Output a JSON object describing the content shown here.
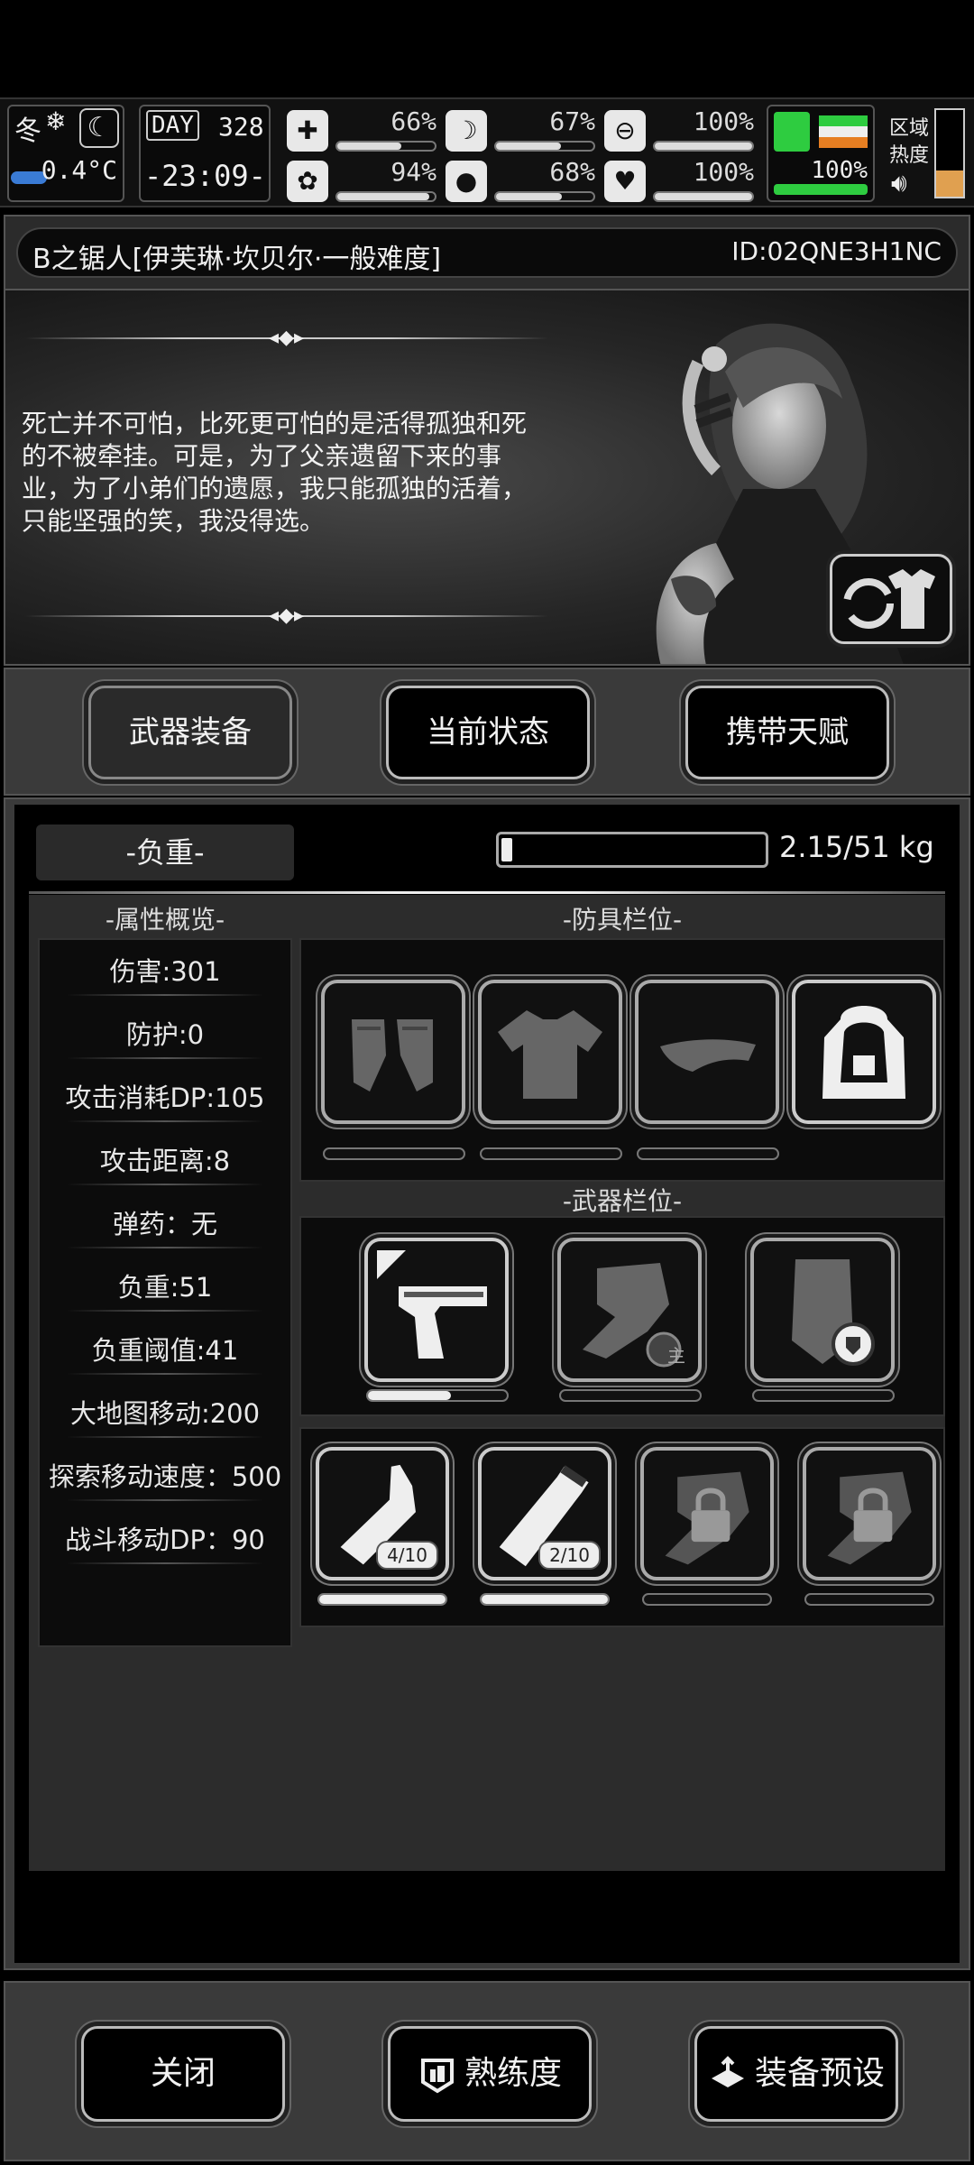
{
  "status": {
    "season": "冬",
    "day_label": "DAY",
    "day_value": "328",
    "temperature": "0.4°C",
    "clock": "-23:09-",
    "stats": [
      {
        "icon": "medkit-icon",
        "pct": "66%",
        "fill": 0.66
      },
      {
        "icon": "stomach-icon",
        "pct": "67%",
        "fill": 0.67
      },
      {
        "icon": "pill-icon",
        "pct": "100%",
        "fill": 1.0
      },
      {
        "icon": "brain-icon",
        "pct": "94%",
        "fill": 0.94
      },
      {
        "icon": "water-drop-icon",
        "pct": "68%",
        "fill": 0.68
      },
      {
        "icon": "heart-icon",
        "pct": "100%",
        "fill": 1.0
      }
    ],
    "stamina_pct": "100%",
    "region_heat_label_1": "区域",
    "region_heat_label_2": "热度",
    "colors": {
      "boot": "#2ecc40",
      "flag_green": "#2ecc40",
      "flag_white": "#eeeeee",
      "flag_orange": "#e67e22",
      "heat": "#e0a050"
    }
  },
  "character": {
    "name": "B之锯人[伊芙琳·坎贝尔·一般难度]",
    "id": "ID:02QNE3H1NC",
    "quote": "死亡并不可怕，比死更可怕的是活得孤独和死的不被牵挂。可是，为了父亲遗留下来的事业，为了小弟们的遗愿，我只能孤独的活着，只能坚强的笑，我没得选。"
  },
  "tabs": {
    "weapons": "武器装备",
    "status": "当前状态",
    "talents": "携带天赋"
  },
  "load": {
    "title": "-负重-",
    "value_text": "2.15/51 kg",
    "fraction": 0.042
  },
  "attributes": {
    "title": "-属性概览-",
    "items": [
      "伤害:301",
      "防护:0",
      "攻击消耗DP:105",
      "攻击距离:8",
      "弹药：无",
      "负重:51",
      "负重阈值:41",
      "大地图移动:200",
      "探索移动速度：500",
      "战斗移动DP：90"
    ]
  },
  "armor": {
    "title": "-防具栏位-",
    "slots": [
      {
        "icon": "gloves-icon"
      },
      {
        "icon": "shirt-icon"
      },
      {
        "icon": "cap-icon"
      },
      {
        "icon": "backpack-icon"
      }
    ]
  },
  "weapons": {
    "title": "-武器栏位-",
    "slots": [
      {
        "icon": "pistol-icon",
        "durability": 0.6
      },
      {
        "icon": "fist-icon",
        "badge": "主"
      },
      {
        "icon": "riot-shield-icon"
      }
    ]
  },
  "items": {
    "slots": [
      {
        "icon": "molotov-icon",
        "count": "4/10",
        "fill": 1.0
      },
      {
        "icon": "flare-icon",
        "count": "2/10",
        "fill": 1.0
      },
      {
        "icon": "locked-slot-icon"
      },
      {
        "icon": "locked-slot-icon"
      }
    ]
  },
  "bottom": {
    "close": "关闭",
    "proficiency": "熟练度",
    "preset": "装备预设"
  }
}
